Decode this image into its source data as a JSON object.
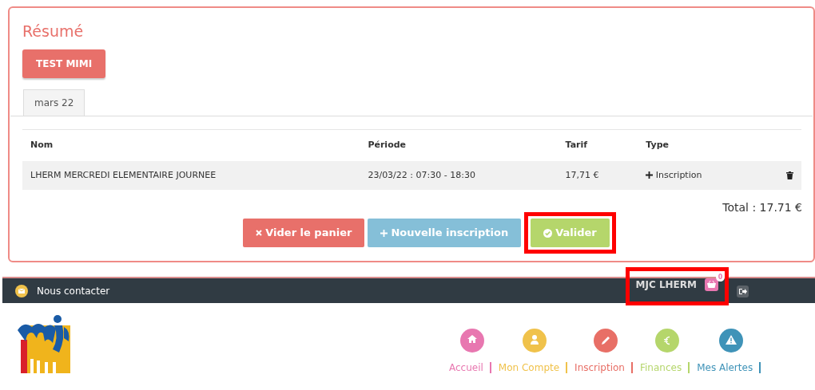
{
  "summary": {
    "title": "Résumé",
    "person_button": "TEST MIMI",
    "tabs": [
      {
        "label": "mars 22",
        "selected": true
      }
    ],
    "table": {
      "columns": [
        "Nom",
        "Période",
        "Tarif",
        "Type"
      ],
      "rows": [
        {
          "nom": "LHERM MERCREDI ELEMENTAIRE JOURNEE",
          "periode": "23/03/22 : 07:30 - 18:30",
          "tarif": "17,71 €",
          "type": "Inscription"
        }
      ]
    },
    "total": "Total : 17.71 €",
    "buttons": [
      {
        "label": "Vider le panier",
        "kind": "clear",
        "highlighted": false
      },
      {
        "label": "Nouvelle inscription",
        "kind": "add",
        "highlighted": false
      },
      {
        "label": "Valider",
        "kind": "validate",
        "highlighted": true
      }
    ]
  },
  "topbar": {
    "contact": "Nous contacter",
    "user": "MJC LHERM",
    "cart_count": "0",
    "highlighted": true
  },
  "nav": [
    {
      "label": "Accueil",
      "kind": "home",
      "color": "#e877b0"
    },
    {
      "label": "Mon Compte",
      "kind": "user",
      "color": "#f0c24b"
    },
    {
      "label": "Inscription",
      "kind": "pencil",
      "color": "#e86f66"
    },
    {
      "label": "Finances",
      "kind": "euro",
      "color": "#b5d66b"
    },
    {
      "label": "Mes Alertes",
      "kind": "alert",
      "color": "#3f93b8"
    }
  ]
}
